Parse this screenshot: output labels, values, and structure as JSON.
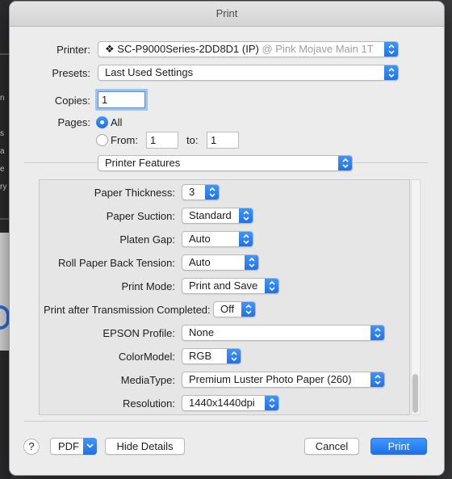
{
  "window": {
    "title": "Print"
  },
  "printer": {
    "label": "Printer:",
    "icon": "printer-glyph-icon",
    "name": "SC-P9000Series-2DD8D1 (IP)",
    "location": "@ Pink Mojave Main 1T"
  },
  "presets": {
    "label": "Presets:",
    "value": "Last Used Settings"
  },
  "copies": {
    "label": "Copies:",
    "value": "1"
  },
  "pages": {
    "label": "Pages:",
    "all_label": "All",
    "from_label": "From:",
    "from_value": "1",
    "to_label": "to:",
    "to_value": "1",
    "selected": "all"
  },
  "section": {
    "value": "Printer Features"
  },
  "features": [
    {
      "label": "Paper Thickness:",
      "value": "3"
    },
    {
      "label": "Paper Suction:",
      "value": "Standard"
    },
    {
      "label": "Platen Gap:",
      "value": "Auto"
    },
    {
      "label": "Roll Paper Back Tension:",
      "value": "Auto"
    },
    {
      "label": "Print Mode:",
      "value": "Print and Save"
    },
    {
      "label": "Print after Transmission Completed:",
      "value": "Off"
    },
    {
      "label": "EPSON Profile:",
      "value": "None"
    },
    {
      "label": "ColorModel:",
      "value": "RGB"
    },
    {
      "label": "MediaType:",
      "value": "Premium Luster Photo Paper (260)"
    },
    {
      "label": "Resolution:",
      "value": "1440x1440dpi"
    }
  ],
  "footer": {
    "help_label": "?",
    "pdf_label": "PDF",
    "hide_details_label": "Hide Details",
    "cancel_label": "Cancel",
    "print_label": "Print"
  },
  "background": {
    "letters": [
      "n",
      "s",
      "a",
      "e",
      "ry"
    ]
  },
  "colors": {
    "accent": "#2c80f5",
    "sheet": "#ececec"
  }
}
